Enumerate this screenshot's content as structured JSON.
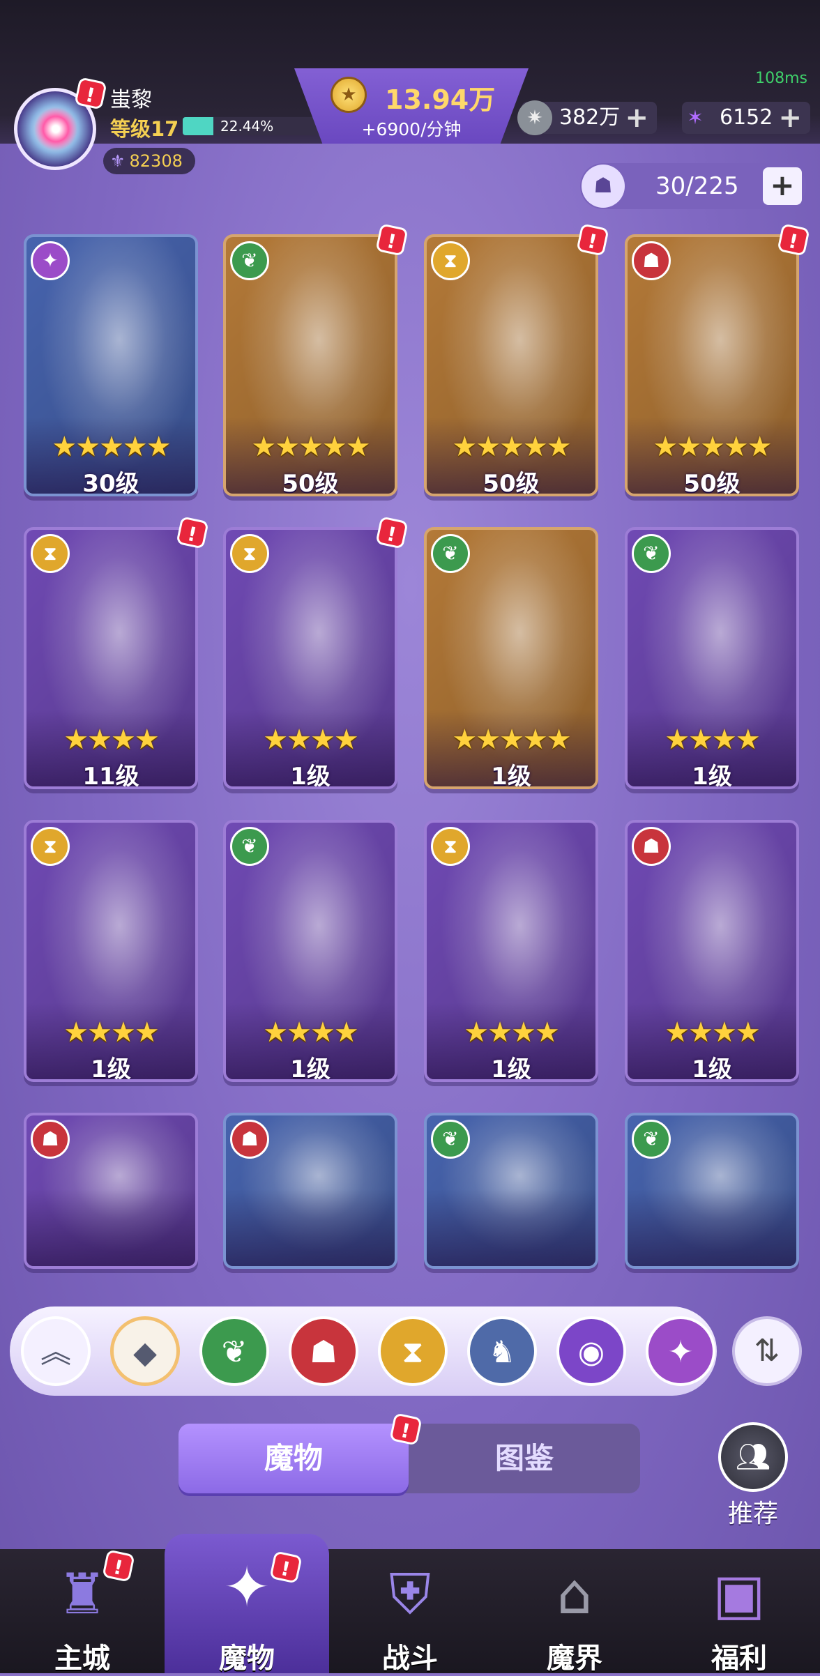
{
  "status": {
    "ping": "108ms"
  },
  "player": {
    "name": "蚩黎",
    "level": "等级17",
    "xp_percent": "22.44%",
    "xp_fraction": 0.2244,
    "power": "82308"
  },
  "currency": {
    "gold": "13.94万",
    "gold_rate": "+6900/分钟",
    "silver": "382万",
    "gems": "6152"
  },
  "roster": {
    "capacity": "30/225"
  },
  "cards": [
    {
      "level": "30级",
      "stars": 5,
      "element": "mystic-icon",
      "bg": "#4f6fc2",
      "alert": false
    },
    {
      "level": "50级",
      "stars": 5,
      "element": "nature-icon",
      "bg": "#c8873e",
      "alert": true
    },
    {
      "level": "50级",
      "stars": 5,
      "element": "time-icon",
      "bg": "#c8873e",
      "alert": true
    },
    {
      "level": "50级",
      "stars": 5,
      "element": "demon-icon",
      "bg": "#c8873e",
      "alert": true
    },
    {
      "level": "11级",
      "stars": 4,
      "element": "time-icon",
      "bg": "#7c52c8",
      "alert": true
    },
    {
      "level": "1级",
      "stars": 4,
      "element": "time-icon",
      "bg": "#7c52c8",
      "alert": true
    },
    {
      "level": "1级",
      "stars": 5,
      "element": "nature-icon",
      "bg": "#c8873e",
      "alert": false
    },
    {
      "level": "1级",
      "stars": 4,
      "element": "nature-icon",
      "bg": "#7c52c8",
      "alert": false
    },
    {
      "level": "1级",
      "stars": 4,
      "element": "time-icon",
      "bg": "#7c52c8",
      "alert": false
    },
    {
      "level": "1级",
      "stars": 4,
      "element": "nature-icon",
      "bg": "#7c52c8",
      "alert": false
    },
    {
      "level": "1级",
      "stars": 4,
      "element": "time-icon",
      "bg": "#7c52c8",
      "alert": false
    },
    {
      "level": "1级",
      "stars": 4,
      "element": "demon-icon",
      "bg": "#7c52c8",
      "alert": false
    },
    {
      "level": "",
      "stars": 0,
      "element": "demon-icon",
      "bg": "#7c52c8",
      "alert": false
    },
    {
      "level": "",
      "stars": 0,
      "element": "demon-icon",
      "bg": "#4f6fc2",
      "alert": false
    },
    {
      "level": "",
      "stars": 0,
      "element": "nature-icon",
      "bg": "#4f6fc2",
      "alert": false
    },
    {
      "level": "",
      "stars": 0,
      "element": "nature-icon",
      "bg": "#4f6fc2",
      "alert": false
    }
  ],
  "filters": [
    {
      "name": "collapse-icon",
      "glyph": "︽",
      "color": "#f4f0ff"
    },
    {
      "name": "all-icon",
      "glyph": "◆",
      "color": "#f8f2e8"
    },
    {
      "name": "nature-icon",
      "glyph": "❦",
      "color": "#3c9a4e"
    },
    {
      "name": "demon-icon",
      "glyph": "☗",
      "color": "#c8343c"
    },
    {
      "name": "time-icon",
      "glyph": "⧗",
      "color": "#e0a72c"
    },
    {
      "name": "dragon-icon",
      "glyph": "♞",
      "color": "#4f6aa8"
    },
    {
      "name": "eye-icon",
      "glyph": "◉",
      "color": "#7c46c8"
    },
    {
      "name": "mystic-icon",
      "glyph": "✦",
      "color": "#9b4cc8"
    }
  ],
  "tabs": {
    "monsters": "魔物",
    "codex": "图鉴"
  },
  "recommend": "推荐",
  "nav": [
    {
      "label": "主城",
      "icon": "castle-icon",
      "glyph": "♜"
    },
    {
      "label": "魔物",
      "icon": "monster-egg-icon",
      "glyph": "✦"
    },
    {
      "label": "战斗",
      "icon": "shield-icon",
      "glyph": "⛨"
    },
    {
      "label": "魔界",
      "icon": "portal-lock-icon",
      "glyph": "⌂"
    },
    {
      "label": "福利",
      "icon": "treasure-chest-icon",
      "glyph": "▣"
    }
  ]
}
